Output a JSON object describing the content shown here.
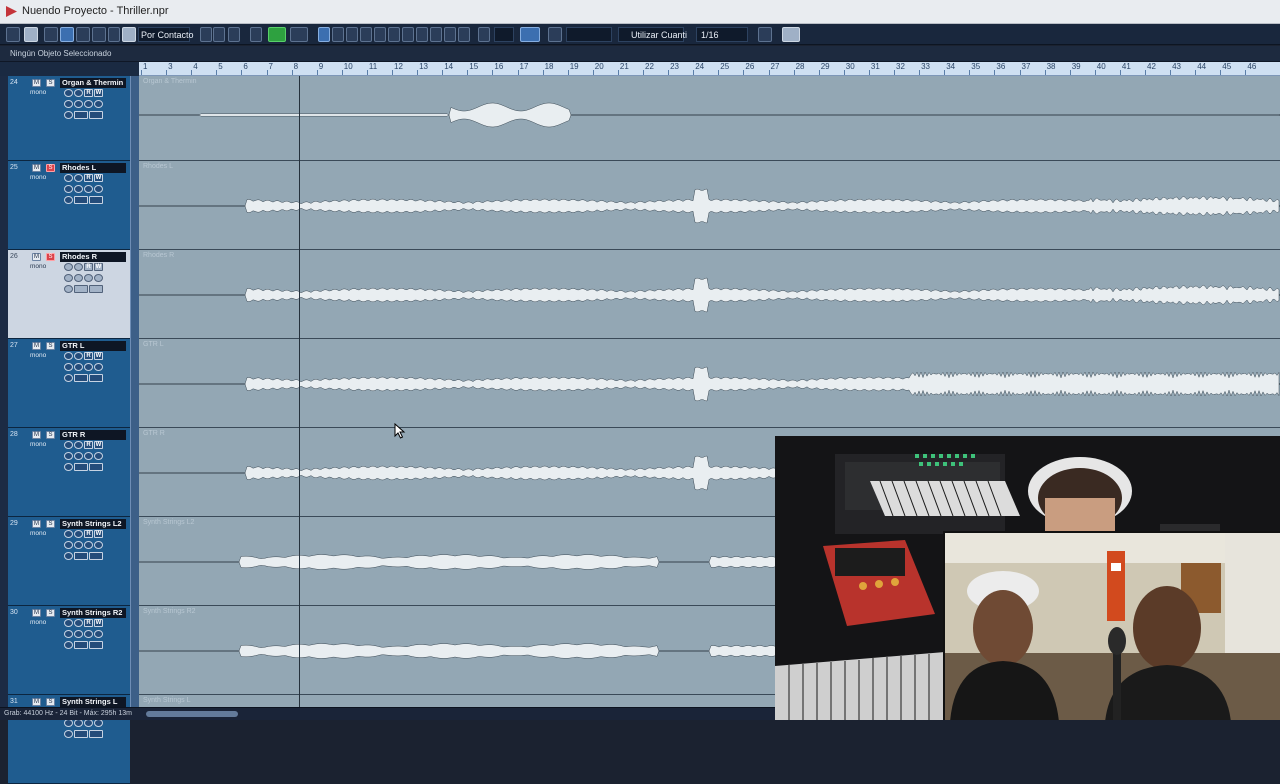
{
  "window": {
    "title": "Nuendo Proyecto - Thriller.npr"
  },
  "toolbar": {
    "contact_mode": "Por Contacto",
    "quantize_label": "Utilizar Cuanti",
    "quantize_value": "1/16"
  },
  "status": {
    "selection": "Ningún Objeto Seleccionado"
  },
  "ruler": {
    "bars": [
      "1",
      "3",
      "4",
      "5",
      "6",
      "7",
      "8",
      "9",
      "10",
      "11",
      "12",
      "13",
      "14",
      "15",
      "16",
      "17",
      "18",
      "19",
      "20",
      "21",
      "22",
      "23",
      "24",
      "25",
      "26",
      "27",
      "28",
      "29",
      "30",
      "31",
      "32",
      "33",
      "34",
      "35",
      "36",
      "37",
      "38",
      "39",
      "40",
      "41",
      "42",
      "43",
      "44",
      "45",
      "46"
    ]
  },
  "tracks": [
    {
      "num": "24",
      "name": "Organ & Thermin",
      "mode": "mono",
      "event": "Organ & Thermin",
      "selected": false,
      "solo": false
    },
    {
      "num": "25",
      "name": "Rhodes L",
      "mode": "mono",
      "event": "Rhodes L",
      "selected": false,
      "solo": true
    },
    {
      "num": "26",
      "name": "Rhodes R",
      "mode": "mono",
      "event": "Rhodes R",
      "selected": true,
      "solo": true
    },
    {
      "num": "27",
      "name": "GTR L",
      "mode": "mono",
      "event": "GTR L",
      "selected": false,
      "solo": false
    },
    {
      "num": "28",
      "name": "GTR R",
      "mode": "mono",
      "event": "GTR R",
      "selected": false,
      "solo": false
    },
    {
      "num": "29",
      "name": "Synth Strings L2",
      "mode": "mono",
      "event": "Synth Strings L2",
      "selected": false,
      "solo": false
    },
    {
      "num": "30",
      "name": "Synth Strings R2",
      "mode": "mono",
      "event": "Synth Strings R2",
      "selected": false,
      "solo": false
    },
    {
      "num": "31",
      "name": "Synth Strings L",
      "mode": "mono",
      "event": "Synth Strings L",
      "selected": false,
      "solo": false
    }
  ],
  "footer": {
    "info": "Grab: 44100 Hz - 24 Bit - Máx: 295h 13m"
  },
  "colors": {
    "lane_bg": "#93a7b4",
    "header_bg": "#1f5c8f",
    "wave": "#e9eef1",
    "solo": "#d9424a",
    "play": "#2ea140"
  }
}
